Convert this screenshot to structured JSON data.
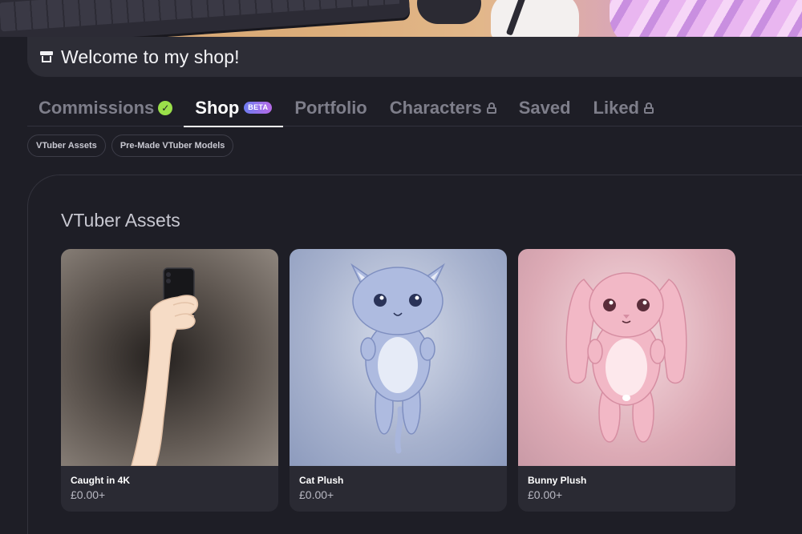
{
  "header": {
    "welcome_text": "Welcome to my shop!",
    "icon": "shop-icon"
  },
  "tabs": [
    {
      "label": "Commissions",
      "badge": "check",
      "active": false
    },
    {
      "label": "Shop",
      "badge": "BETA",
      "active": true
    },
    {
      "label": "Portfolio",
      "active": false
    },
    {
      "label": "Characters",
      "badge": "lock",
      "active": false
    },
    {
      "label": "Saved",
      "active": false
    },
    {
      "label": "Liked",
      "badge": "lock",
      "active": false
    }
  ],
  "chips": [
    {
      "label": "VTuber Assets"
    },
    {
      "label": "Pre-Made VTuber Models"
    }
  ],
  "section": {
    "title": "VTuber Assets"
  },
  "products": [
    {
      "name": "Caught in 4K",
      "price": "£0.00+"
    },
    {
      "name": "Cat Plush",
      "price": "£0.00+"
    },
    {
      "name": "Bunny Plush",
      "price": "£0.00+"
    }
  ],
  "colors": {
    "background": "#1e1e26",
    "card": "#2a2a33",
    "check_badge": "#9be04a",
    "beta_gradient_start": "#6e7cf0",
    "beta_gradient_end": "#b56ae6"
  }
}
